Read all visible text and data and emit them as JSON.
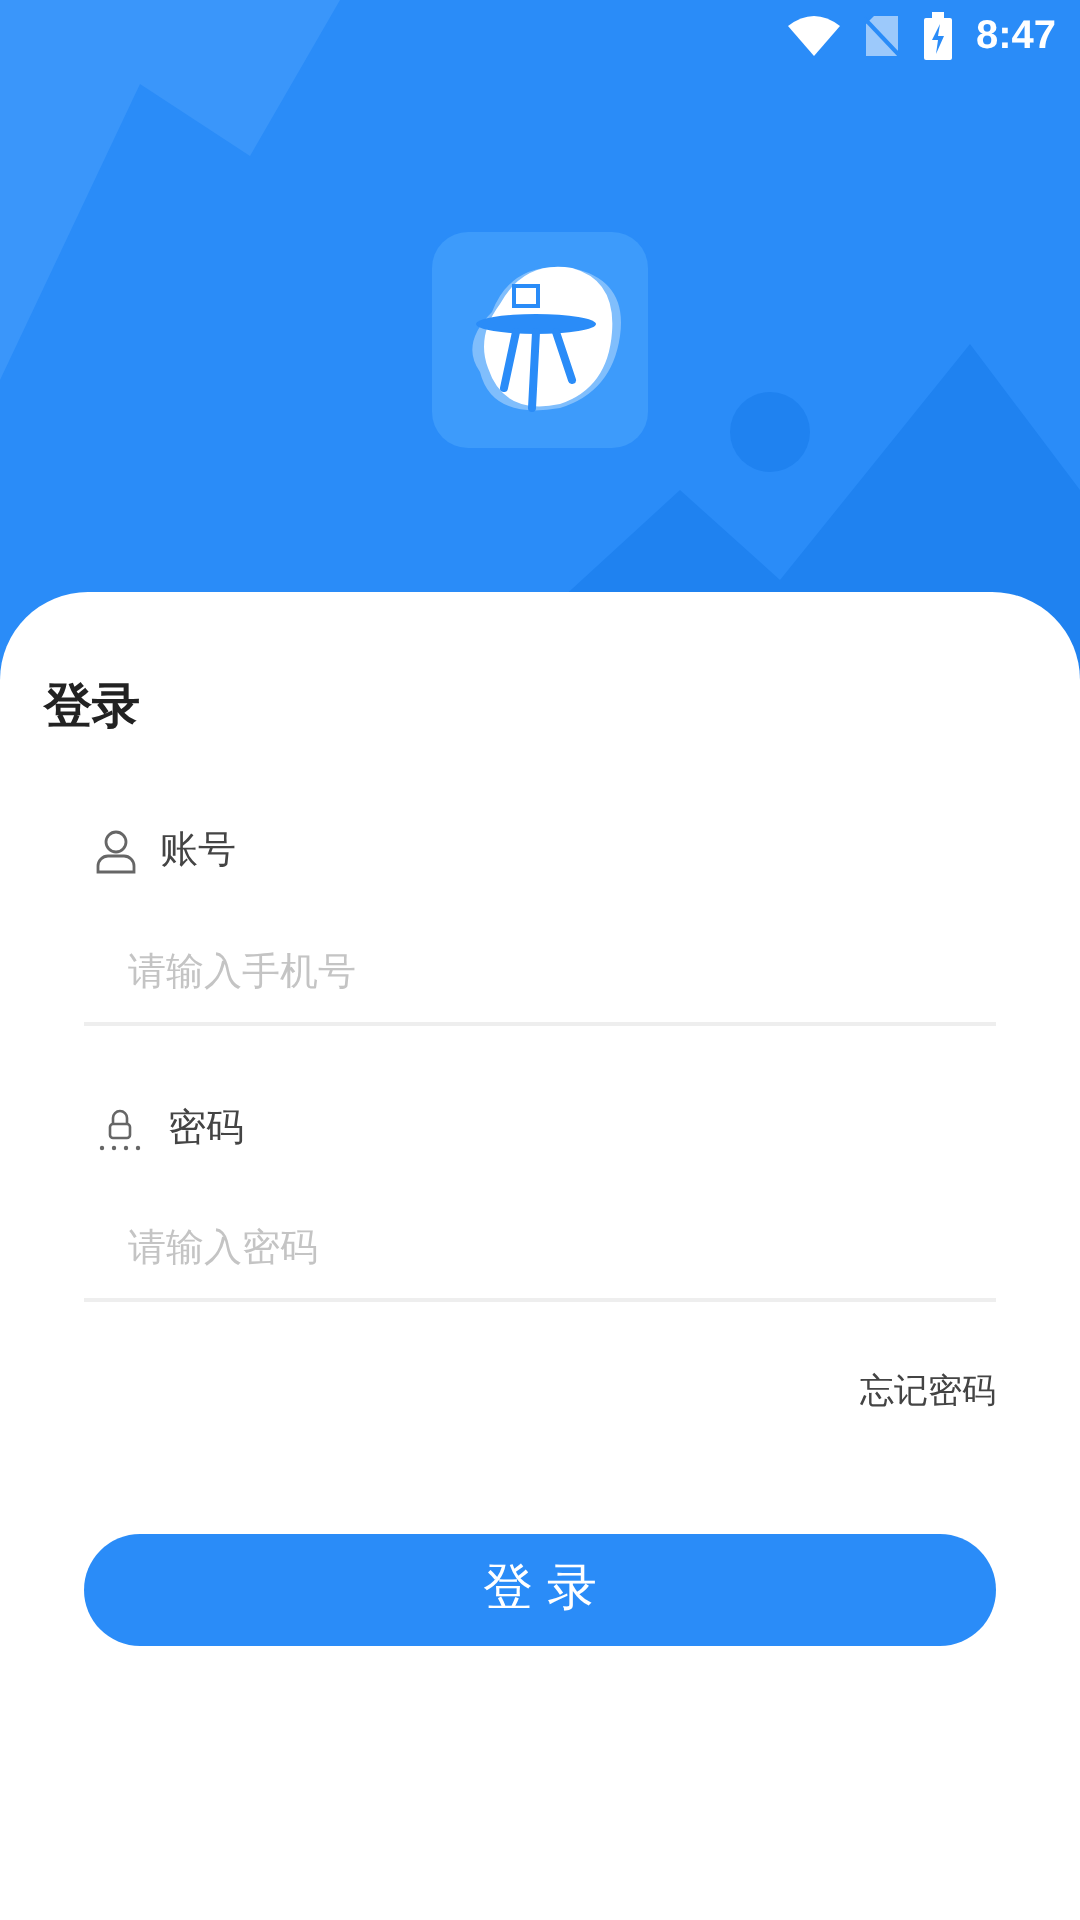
{
  "status_bar": {
    "time": "8:47"
  },
  "title": "登录",
  "fields": [
    {
      "kind": "account",
      "label": "账号",
      "placeholder": "请输入手机号"
    },
    {
      "kind": "password",
      "label": "密码",
      "placeholder": "请输入密码"
    }
  ],
  "forgot_link": "忘记密码",
  "login_button": "登 录"
}
